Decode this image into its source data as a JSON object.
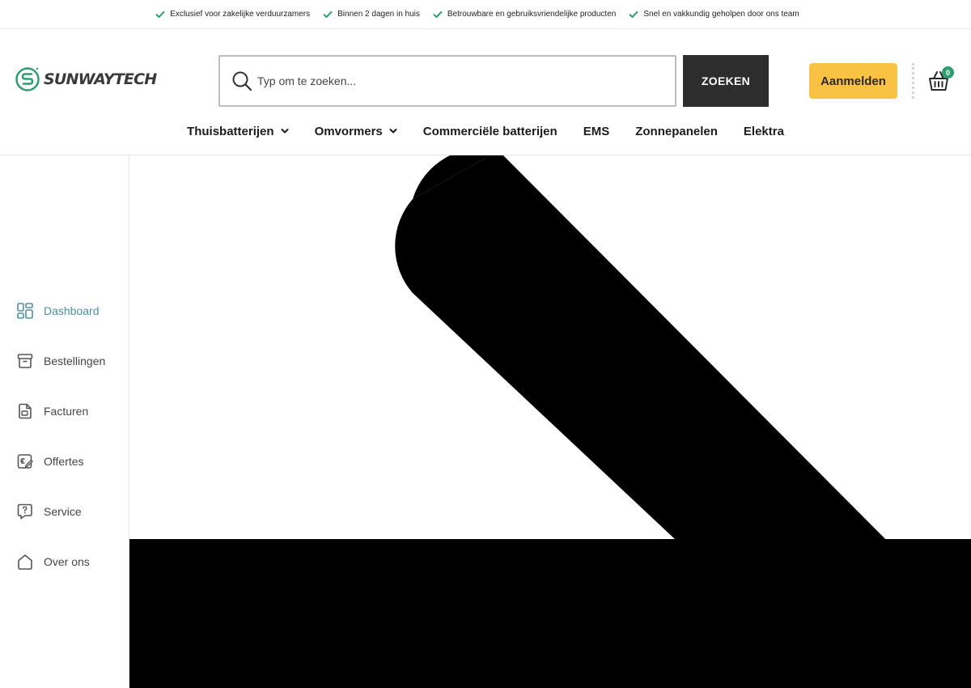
{
  "usp": [
    "Exclusief voor zakelijke verduurzamers",
    "Binnen 2 dagen in huis",
    "Betrouwbare en gebruiksvriendelijke producten",
    "Snel en vakkundig geholpen door ons team"
  ],
  "brand": {
    "name": "SUNWAYTECH",
    "accent": "#2e9e6e"
  },
  "search": {
    "placeholder": "Typ om te zoeken...",
    "button_label": "ZOEKEN"
  },
  "header": {
    "login_label": "Aanmelden",
    "cart_count": "0",
    "login_color": "#f9c242"
  },
  "nav": [
    {
      "label": "Thuisbatterijen",
      "dropdown": true
    },
    {
      "label": "Omvormers",
      "dropdown": true
    },
    {
      "label": "Commerciële batterijen",
      "dropdown": false
    },
    {
      "label": "EMS",
      "dropdown": false
    },
    {
      "label": "Zonnepanelen",
      "dropdown": false
    },
    {
      "label": "Elektra",
      "dropdown": false
    }
  ],
  "sidebar": {
    "items": [
      {
        "label": "Dashboard",
        "icon": "dashboard-icon",
        "active": true
      },
      {
        "label": "Bestellingen",
        "icon": "archive-box-icon",
        "active": false
      },
      {
        "label": "Facturen",
        "icon": "invoice-icon",
        "active": false
      },
      {
        "label": "Offertes",
        "icon": "quote-icon",
        "active": false
      },
      {
        "label": "Service",
        "icon": "help-chat-icon",
        "active": false
      },
      {
        "label": "Over ons",
        "icon": "home-icon",
        "active": false
      }
    ]
  }
}
